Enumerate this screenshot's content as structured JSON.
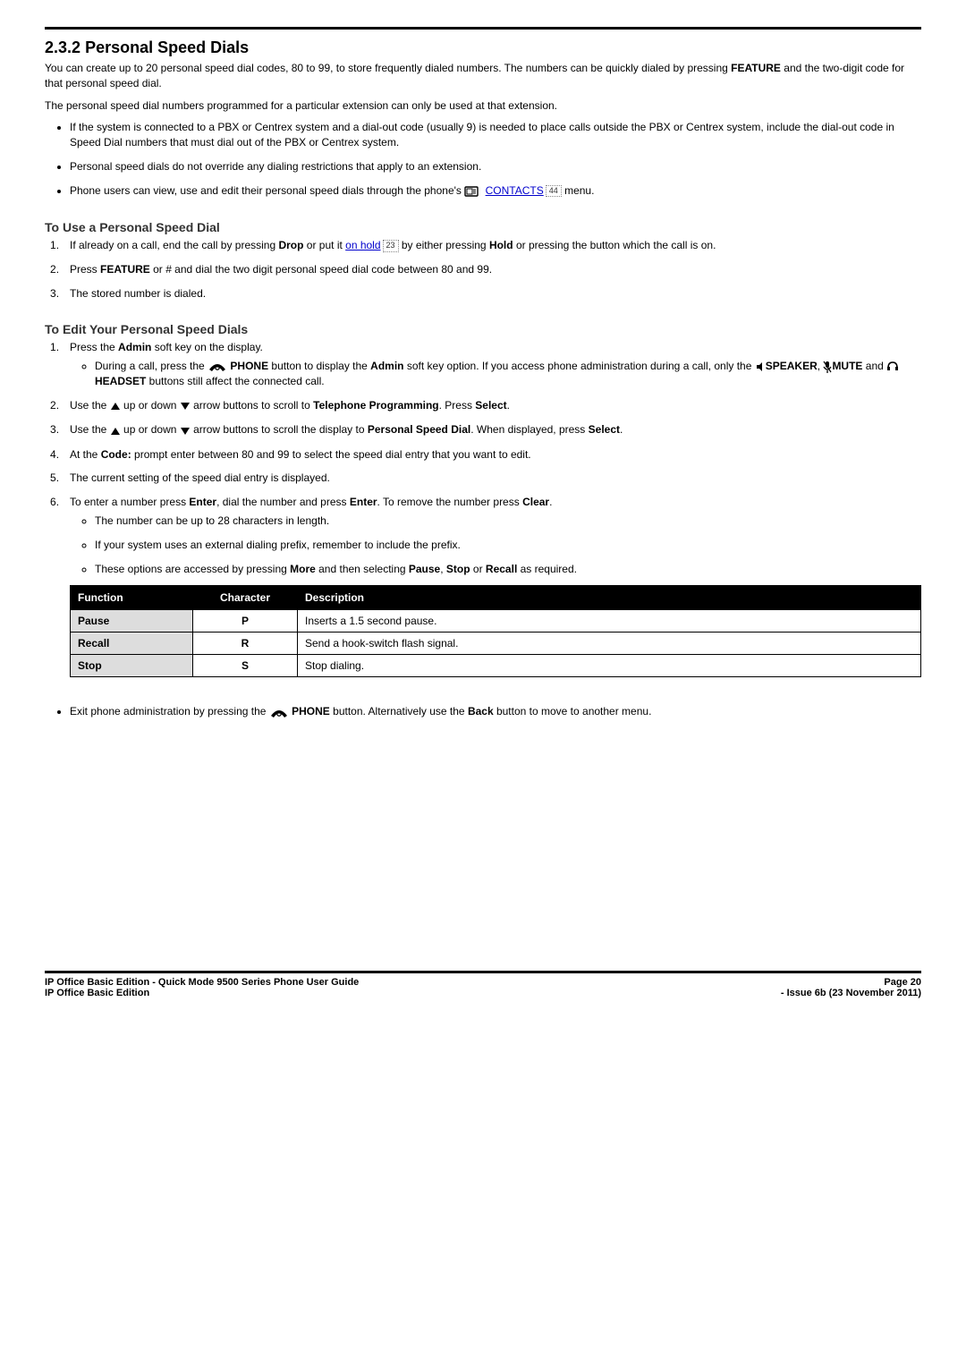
{
  "section": {
    "number": "2.3.2",
    "title": "Personal Speed Dials"
  },
  "intro": {
    "p1_a": "You can create up to 20 personal speed dial codes, 80 to 99, to store frequently dialed numbers. The numbers can be quickly dialed by pressing ",
    "feature": "FEATURE",
    "p1_b": " and the two-digit code for that personal speed dial.",
    "p2": "The personal speed dial numbers programmed for a particular extension can only be used at that extension.",
    "bullets": {
      "b1": "If the system is connected to a PBX or Centrex system and a dial-out code (usually 9) is needed to place calls outside the PBX or Centrex system, include the dial-out code in Speed Dial numbers that must dial out of the PBX or Centrex system.",
      "b2": "Personal speed dials do not override any dialing restrictions that apply to an extension.",
      "b3_a": "Phone users can view, use and edit their personal speed dials through the phone's ",
      "contacts_link": "CONTACTS",
      "contacts_ref": "44",
      "b3_b": " menu."
    }
  },
  "use": {
    "heading": "To Use a Personal Speed Dial",
    "s1_a": "If already on a call, end the call by pressing ",
    "drop": "Drop",
    "s1_b": " or put it ",
    "onhold_link": "on hold",
    "onhold_ref": "23",
    "s1_c": " by either pressing ",
    "hold": "Hold",
    "s1_d": " or pressing the button which the call is on.",
    "s2_a": "Press ",
    "feature": "FEATURE",
    "s2_b": " or ",
    "hash": "#",
    "s2_c": " and dial the two digit personal speed dial code between 80 and 99.",
    "s3": "The stored number is dialed."
  },
  "edit": {
    "heading": "To Edit Your Personal Speed Dials",
    "s1": {
      "text_a": "Press the ",
      "admin": "Admin",
      "text_b": " soft key on the display.",
      "sub_a": "During a call, press the ",
      "phone": "PHONE",
      "sub_b": " button to display the ",
      "sub_c": " soft key option. If you access phone administration during a call, only the ",
      "speaker": "SPEAKER",
      "mute": "MUTE",
      "headset": "HEADSET",
      "and": " and ",
      "comma": ", ",
      "sub_d": " buttons still affect the connected call."
    },
    "s2": {
      "a": "Use the ",
      "b": " up or down ",
      "c": " arrow buttons to scroll to ",
      "tp": "Telephone Programming",
      "d": ". Press ",
      "select": "Select",
      "e": "."
    },
    "s3": {
      "a": "Use the ",
      "b": " up or down ",
      "c": " arrow buttons to scroll the display to ",
      "psd": "Personal Speed Dial",
      "d": ". When displayed, press ",
      "select": "Select",
      "e": "."
    },
    "s4": {
      "a": "At the ",
      "code": "Code:",
      "b": " prompt enter between 80 and 99 to select the speed dial entry that you want to edit."
    },
    "s5": "The current setting of the speed dial entry is displayed.",
    "s6": {
      "a": "To enter a number press ",
      "enter": "Enter",
      "b": ", dial the number and press ",
      "c": ". To remove the number press ",
      "clear": "Clear",
      "d": ".",
      "sub1": "The number can be up to 28 characters in length.",
      "sub2": "If your system uses an external dialing prefix, remember to include the prefix.",
      "sub3_a": "These options are accessed by pressing ",
      "more": "More",
      "sub3_b": " and then selecting ",
      "pause": "Pause",
      "stop": "Stop",
      "recall": "Recall",
      "or": " or ",
      "sub3_c": " as required."
    }
  },
  "table": {
    "headers": {
      "fn": "Function",
      "ch": "Character",
      "desc": "Description"
    },
    "rows": [
      {
        "fn": "Pause",
        "ch": "P",
        "desc": "Inserts a 1.5 second pause."
      },
      {
        "fn": "Recall",
        "ch": "R",
        "desc": "Send a hook-switch flash signal."
      },
      {
        "fn": "Stop",
        "ch": "S",
        "desc": "Stop dialing."
      }
    ]
  },
  "exit": {
    "a": "Exit phone administration by pressing the ",
    "phone": "PHONE",
    "b": " button. Alternatively use the ",
    "back": "Back",
    "c": " button to move to another menu."
  },
  "footer": {
    "left1": "IP Office Basic Edition - Quick Mode 9500 Series Phone User Guide",
    "left2": "IP Office Basic Edition",
    "right1": "Page 20",
    "right2": "- Issue 6b (23 November 2011)"
  },
  "chart_data": null
}
